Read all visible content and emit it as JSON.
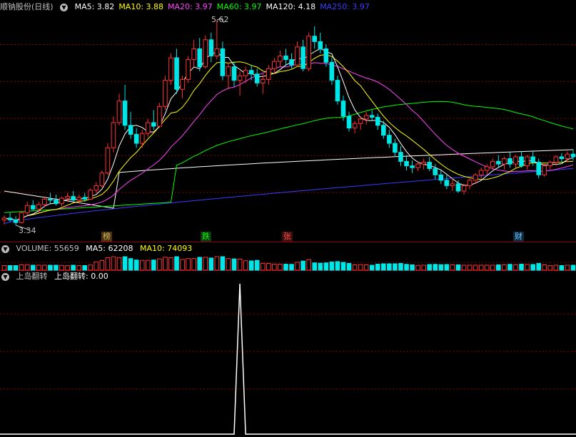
{
  "price_header": {
    "stock": "顺钠股份(日线)",
    "indicators": [
      {
        "label": "MA5: 3.82",
        "color": "#ffffff"
      },
      {
        "label": "MA10: 3.88",
        "color": "#ffff00"
      },
      {
        "label": "MA20: 3.97",
        "color": "#ff44ff"
      },
      {
        "label": "MA60: 3.97",
        "color": "#00ff00"
      },
      {
        "label": "MA120: 4.18",
        "color": "#ffffff"
      },
      {
        "label": "MA250: 3.97",
        "color": "#3b3bff"
      }
    ]
  },
  "price_annotations": {
    "high": "5.62",
    "low": "3.34"
  },
  "markers": [
    {
      "text": "榜",
      "color": "#c0c060",
      "bg": "#503010"
    },
    {
      "text": "跌",
      "color": "#00ff00",
      "bg": "#0f3a0f"
    },
    {
      "text": "张",
      "color": "#ff5050",
      "bg": "#400f0f"
    },
    {
      "text": "财",
      "color": "#66ccff",
      "bg": "#0f2a40"
    }
  ],
  "volume_header": {
    "items": [
      {
        "label": "VOLUME: 55659",
        "color": "#c0c0c0"
      },
      {
        "label": "MA5: 62208",
        "color": "#ffffff"
      },
      {
        "label": "MA10: 74093",
        "color": "#ffff00"
      }
    ]
  },
  "indicator_header": {
    "name": "上岛翻转",
    "value_label": "上岛翻转: 0.00"
  },
  "chart_data": {
    "type": "candlestick",
    "price_range": [
      3.34,
      5.62
    ],
    "ma_colors": {
      "MA5": "#ffffff",
      "MA10": "#ffff00",
      "MA20": "#ff44ff",
      "MA60": "#00ff00",
      "MA120": "#ffffff",
      "MA250": "#3b3bff"
    },
    "up_color": "#ff3232",
    "down_color": "#00e5e5",
    "candles": [
      [
        3.4,
        3.45,
        3.35,
        3.42
      ],
      [
        3.42,
        3.48,
        3.38,
        3.4
      ],
      [
        3.4,
        3.44,
        3.34,
        3.37
      ],
      [
        3.37,
        3.5,
        3.36,
        3.48
      ],
      [
        3.48,
        3.6,
        3.45,
        3.56
      ],
      [
        3.56,
        3.62,
        3.5,
        3.52
      ],
      [
        3.52,
        3.6,
        3.48,
        3.57
      ],
      [
        3.57,
        3.66,
        3.54,
        3.63
      ],
      [
        3.63,
        3.7,
        3.58,
        3.62
      ],
      [
        3.62,
        3.68,
        3.56,
        3.58
      ],
      [
        3.58,
        3.66,
        3.55,
        3.64
      ],
      [
        3.64,
        3.7,
        3.6,
        3.66
      ],
      [
        3.66,
        3.72,
        3.6,
        3.62
      ],
      [
        3.62,
        3.68,
        3.58,
        3.65
      ],
      [
        3.65,
        3.7,
        3.6,
        3.63
      ],
      [
        3.63,
        3.75,
        3.62,
        3.73
      ],
      [
        3.73,
        3.82,
        3.7,
        3.78
      ],
      [
        3.78,
        3.95,
        3.76,
        3.92
      ],
      [
        3.92,
        4.25,
        3.9,
        4.2
      ],
      [
        4.2,
        4.55,
        4.15,
        4.48
      ],
      [
        4.48,
        4.8,
        4.45,
        4.72
      ],
      [
        4.72,
        4.9,
        4.4,
        4.45
      ],
      [
        4.45,
        4.6,
        4.3,
        4.35
      ],
      [
        4.35,
        4.42,
        4.2,
        4.25
      ],
      [
        4.25,
        4.4,
        4.2,
        4.36
      ],
      [
        4.36,
        4.52,
        4.32,
        4.48
      ],
      [
        4.48,
        4.62,
        4.4,
        4.44
      ],
      [
        4.44,
        4.7,
        4.42,
        4.66
      ],
      [
        4.66,
        5.0,
        4.62,
        4.95
      ],
      [
        4.95,
        5.25,
        4.9,
        5.2
      ],
      [
        5.2,
        5.3,
        4.8,
        4.85
      ],
      [
        4.85,
        5.0,
        4.75,
        4.96
      ],
      [
        4.96,
        5.22,
        4.92,
        5.18
      ],
      [
        5.18,
        5.4,
        5.1,
        5.3
      ],
      [
        5.3,
        5.42,
        5.05,
        5.1
      ],
      [
        5.1,
        5.45,
        5.08,
        5.4
      ],
      [
        5.4,
        5.48,
        5.15,
        5.22
      ],
      [
        5.22,
        5.62,
        5.18,
        5.3
      ],
      [
        5.3,
        5.38,
        4.95,
        5.0
      ],
      [
        5.0,
        5.15,
        4.85,
        5.1
      ],
      [
        5.1,
        5.16,
        4.88,
        4.95
      ],
      [
        4.95,
        5.05,
        4.78,
        5.0
      ],
      [
        5.0,
        5.1,
        4.92,
        5.06
      ],
      [
        5.06,
        5.12,
        4.95,
        5.02
      ],
      [
        5.02,
        5.08,
        4.88,
        4.92
      ],
      [
        4.92,
        5.02,
        4.8,
        4.96
      ],
      [
        4.96,
        5.12,
        4.9,
        5.08
      ],
      [
        5.08,
        5.2,
        5.02,
        5.16
      ],
      [
        5.16,
        5.28,
        5.1,
        5.22
      ],
      [
        5.22,
        5.3,
        5.12,
        5.18
      ],
      [
        5.18,
        5.25,
        5.08,
        5.12
      ],
      [
        5.12,
        5.38,
        5.1,
        5.32
      ],
      [
        5.32,
        5.4,
        5.05,
        5.08
      ],
      [
        5.08,
        5.48,
        5.05,
        5.44
      ],
      [
        5.44,
        5.55,
        5.3,
        5.38
      ],
      [
        5.38,
        5.48,
        5.25,
        5.3
      ],
      [
        5.3,
        5.35,
        5.1,
        5.15
      ],
      [
        5.15,
        5.2,
        4.9,
        4.95
      ],
      [
        4.95,
        5.0,
        4.68,
        4.72
      ],
      [
        4.72,
        4.78,
        4.5,
        4.55
      ],
      [
        4.55,
        4.6,
        4.38,
        4.42
      ],
      [
        4.42,
        4.5,
        4.36,
        4.47
      ],
      [
        4.47,
        4.55,
        4.4,
        4.52
      ],
      [
        4.52,
        4.6,
        4.46,
        4.56
      ],
      [
        4.56,
        4.62,
        4.5,
        4.54
      ],
      [
        4.54,
        4.58,
        4.4,
        4.45
      ],
      [
        4.45,
        4.5,
        4.3,
        4.34
      ],
      [
        4.34,
        4.4,
        4.2,
        4.25
      ],
      [
        4.25,
        4.3,
        4.1,
        4.15
      ],
      [
        4.15,
        4.22,
        4.0,
        4.05
      ],
      [
        4.05,
        4.12,
        3.95,
        4.0
      ],
      [
        4.0,
        4.06,
        3.92,
        3.98
      ],
      [
        3.98,
        4.05,
        3.94,
        4.02
      ],
      [
        4.02,
        4.08,
        3.96,
        4.04
      ],
      [
        4.04,
        4.1,
        3.94,
        3.97
      ],
      [
        3.97,
        4.02,
        3.85,
        3.9
      ],
      [
        3.9,
        3.95,
        3.8,
        3.84
      ],
      [
        3.84,
        3.9,
        3.74,
        3.78
      ],
      [
        3.78,
        3.86,
        3.72,
        3.8
      ],
      [
        3.8,
        3.84,
        3.7,
        3.72
      ],
      [
        3.72,
        3.8,
        3.68,
        3.78
      ],
      [
        3.78,
        3.86,
        3.74,
        3.84
      ],
      [
        3.84,
        3.92,
        3.8,
        3.9
      ],
      [
        3.9,
        3.98,
        3.86,
        3.95
      ],
      [
        3.95,
        4.02,
        3.9,
        3.99
      ],
      [
        3.99,
        4.08,
        3.96,
        4.05
      ],
      [
        4.05,
        4.12,
        3.98,
        4.02
      ],
      [
        4.02,
        4.1,
        3.96,
        4.08
      ],
      [
        4.08,
        4.15,
        3.98,
        4.02
      ],
      [
        4.02,
        4.12,
        3.98,
        4.1
      ],
      [
        4.1,
        4.16,
        3.98,
        4.0
      ],
      [
        4.0,
        4.12,
        3.96,
        4.1
      ],
      [
        4.1,
        4.16,
        4.0,
        4.04
      ],
      [
        4.04,
        4.08,
        3.86,
        3.9
      ],
      [
        3.9,
        4.02,
        3.88,
        4.0
      ],
      [
        4.0,
        4.06,
        3.96,
        4.04
      ],
      [
        4.04,
        4.12,
        4.0,
        4.1
      ],
      [
        4.1,
        4.14,
        4.04,
        4.08
      ],
      [
        4.08,
        4.16,
        4.04,
        4.13
      ],
      [
        4.13,
        4.18,
        4.06,
        4.1
      ]
    ],
    "volume_max": 120000,
    "indicator_range": [
      0,
      1
    ],
    "indicator_spike_index": 41,
    "indicator_value": 1
  }
}
